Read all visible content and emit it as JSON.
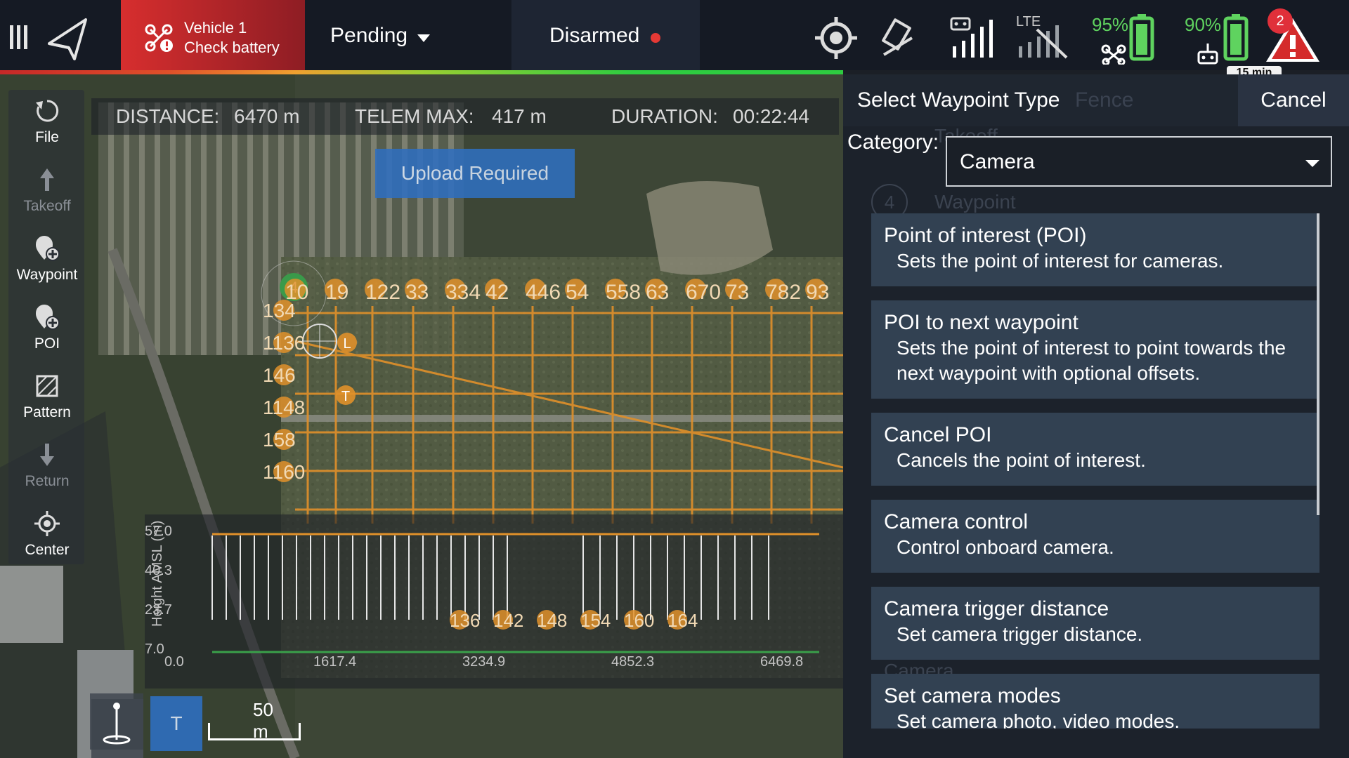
{
  "topbar": {
    "vehicle_line1": "Vehicle 1",
    "vehicle_line2": "Check battery",
    "flight_mode": "Pending",
    "arm_status": "Disarmed",
    "signal_label": "LTE",
    "vehicle_battery": "95%",
    "controller_battery": "90%",
    "alert_count": "2",
    "flight_time": "15 min"
  },
  "toolbar": {
    "file": "File",
    "takeoff": "Takeoff",
    "waypoint": "Waypoint",
    "poi": "POI",
    "pattern": "Pattern",
    "return": "Return",
    "center": "Center"
  },
  "telemetry": {
    "distance_label": "DISTANCE:",
    "distance_value": "6470 m",
    "telem_label": "TELEM MAX:",
    "telem_value": "417 m",
    "duration_label": "DURATION:",
    "duration_value": "00:22:44"
  },
  "upload_button": "Upload Required",
  "map": {
    "top_labels": [
      "10",
      "19",
      "122",
      "33",
      "334",
      "42",
      "446",
      "54",
      "558",
      "63",
      "670",
      "73",
      "782",
      "93",
      "9"
    ],
    "left_labels": [
      "134",
      "1136",
      "146",
      "1148",
      "158",
      "1160"
    ],
    "marker_L": "L",
    "marker_T": "T",
    "current_marker": "4",
    "home_label": "T"
  },
  "profile": {
    "ylabel": "Height AMSL (m)",
    "y_ticks": [
      "57.0",
      "40.3",
      "23.7",
      "7.0"
    ],
    "x_ticks": [
      "0.0",
      "1617.4",
      "3234.9",
      "4852.3",
      "6469.8"
    ],
    "bottom_labels": [
      "136",
      "142",
      "148",
      "154",
      "160",
      "164"
    ]
  },
  "scale": {
    "label": "50 m"
  },
  "right_panel": {
    "title": "Select Waypoint Type",
    "tab_fence": "Fence",
    "cancel": "Cancel",
    "category_label": "Category:",
    "category_value": "Camera",
    "ghost_takeoff": "Takeoff",
    "ghost_item_num": "4",
    "ghost_item_type": "Waypoint",
    "ghost_section": "Camera",
    "items": [
      {
        "title": "Point of interest (POI)",
        "desc": "Sets the point of interest for cameras."
      },
      {
        "title": "POI to next waypoint",
        "desc": "Sets the point of interest to point towards the next waypoint with optional offsets."
      },
      {
        "title": "Cancel POI",
        "desc": "Cancels the point of interest."
      },
      {
        "title": "Camera control",
        "desc": "Control onboard camera."
      },
      {
        "title": "Camera trigger distance",
        "desc": "Set camera trigger distance."
      },
      {
        "title": "Set camera modes",
        "desc": "Set camera photo, video modes."
      }
    ]
  },
  "colors": {
    "accent_orange": "#e0902a",
    "alert_red": "#e0303a",
    "battery_green": "#5fd35f",
    "list_item_bg": "#324152"
  }
}
